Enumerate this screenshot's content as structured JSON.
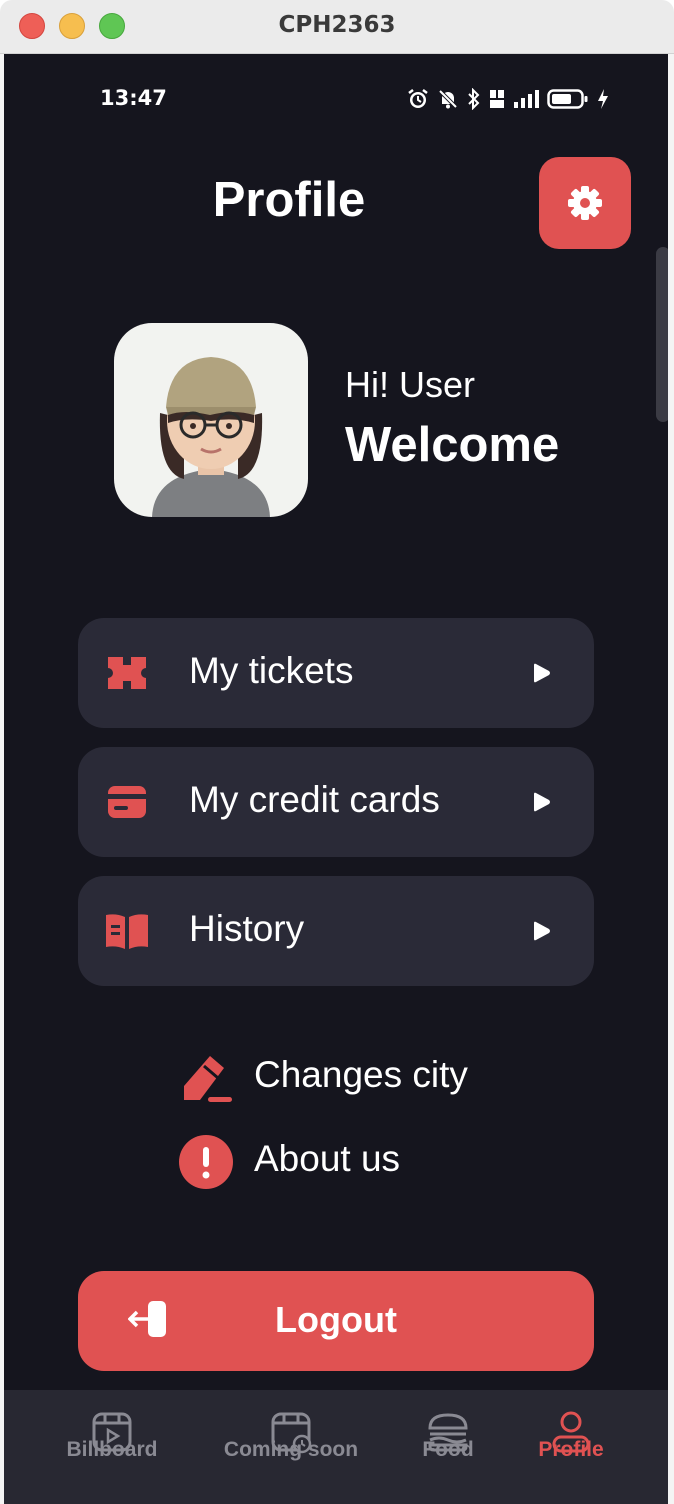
{
  "window": {
    "title": "CPH2363"
  },
  "status_bar": {
    "time": "13:47"
  },
  "header": {
    "title": "Profile",
    "settings_icon": "gear-icon"
  },
  "greeting": {
    "line1": "Hi! User",
    "line2": "Welcome"
  },
  "menu": [
    {
      "label": "My tickets",
      "icon": "ticket-icon"
    },
    {
      "label": "My credit cards",
      "icon": "credit-card-icon"
    },
    {
      "label": "History",
      "icon": "book-icon"
    }
  ],
  "links": [
    {
      "label": "Changes city",
      "icon": "edit-pen-icon"
    },
    {
      "label": "About us",
      "icon": "alert-info-icon"
    }
  ],
  "logout": {
    "label": "Logout",
    "icon": "logout-icon"
  },
  "tabs": [
    {
      "label": "Billboard",
      "icon": "billboard-icon",
      "active": false
    },
    {
      "label": "Coming soon",
      "icon": "calendar-clock-icon",
      "active": false
    },
    {
      "label": "Food",
      "icon": "burger-icon",
      "active": false
    },
    {
      "label": "Profile",
      "icon": "user-icon",
      "active": true
    }
  ],
  "colors": {
    "accent": "#e05252",
    "background": "#15151e",
    "card": "#2a2a37",
    "tabbar": "#282832",
    "tab_inactive": "#8a8a93"
  }
}
